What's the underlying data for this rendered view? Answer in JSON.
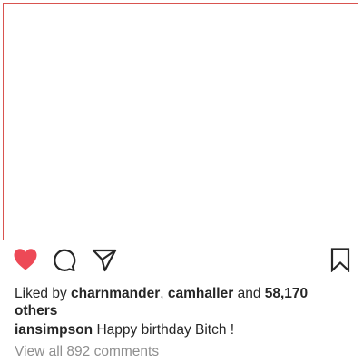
{
  "post": {
    "likes": {
      "prefix": "Liked by ",
      "user_one": "charnmander",
      "separator": ", ",
      "user_two": "camhaller",
      "conjunction": " and ",
      "count_text": "58,170 others"
    },
    "caption": {
      "username": "iansimpson",
      "text": "Happy birthday Bitch !"
    },
    "view_comments": "View all 892 comments"
  },
  "icons": {
    "like": "heart-icon",
    "comment": "speech-bubble-icon",
    "share": "paper-plane-icon",
    "save": "bookmark-icon"
  },
  "colors": {
    "liked_heart": "#ed4956",
    "frame_border": "#d9534f",
    "muted_text": "#8e8e8e"
  }
}
